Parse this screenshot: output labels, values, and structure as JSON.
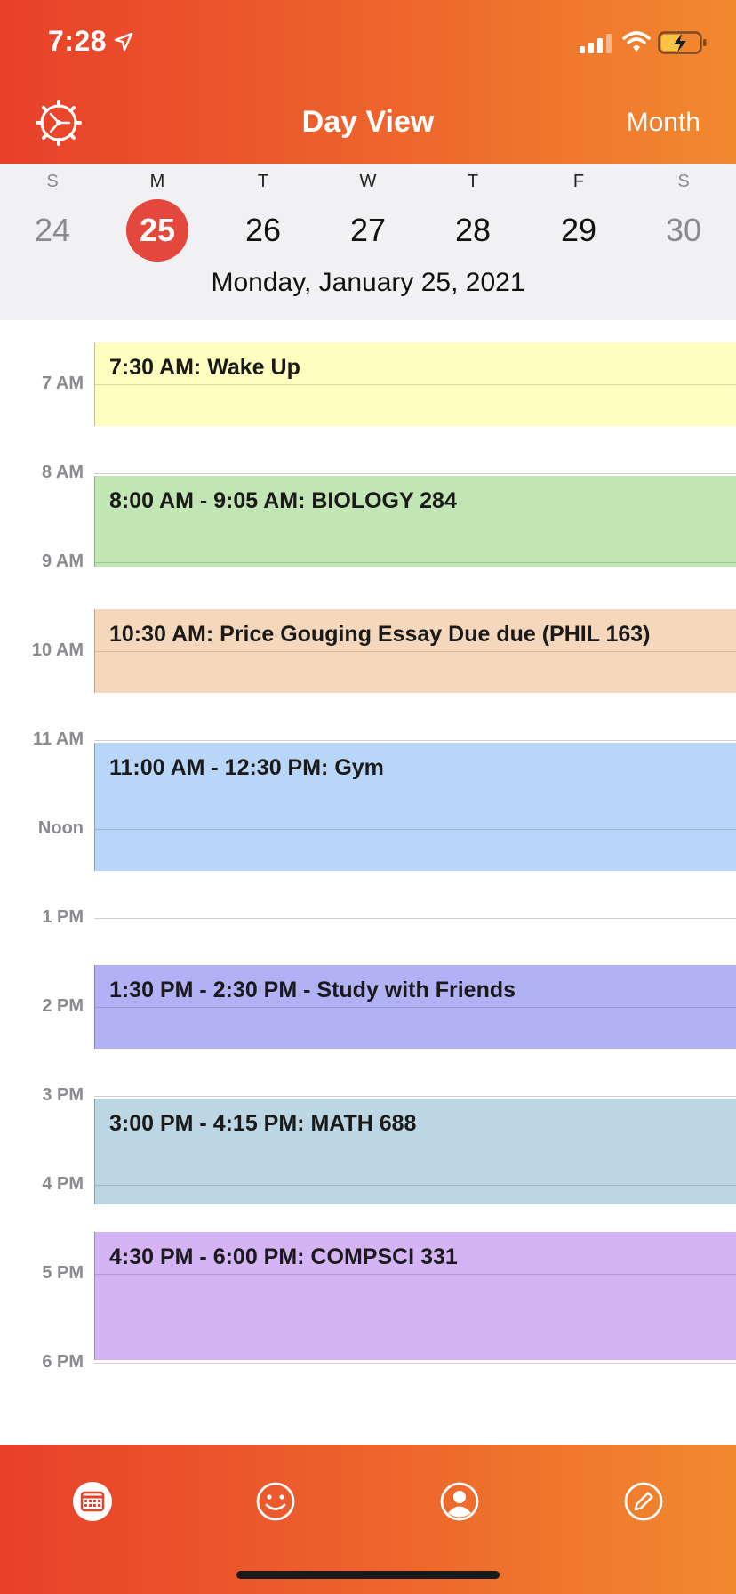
{
  "status_bar": {
    "time": "7:28"
  },
  "header": {
    "title": "Day View",
    "month_button": "Month"
  },
  "week": {
    "days": [
      {
        "dow": "S",
        "num": "24",
        "weekend": true,
        "selected": false
      },
      {
        "dow": "M",
        "num": "25",
        "weekend": false,
        "selected": true
      },
      {
        "dow": "T",
        "num": "26",
        "weekend": false,
        "selected": false
      },
      {
        "dow": "W",
        "num": "27",
        "weekend": false,
        "selected": false
      },
      {
        "dow": "T",
        "num": "28",
        "weekend": false,
        "selected": false
      },
      {
        "dow": "F",
        "num": "29",
        "weekend": false,
        "selected": false
      },
      {
        "dow": "S",
        "num": "30",
        "weekend": true,
        "selected": false
      }
    ],
    "full_date": "Monday, January 25, 2021"
  },
  "timeline": {
    "hours": [
      "7 AM",
      "8 AM",
      "9 AM",
      "10 AM",
      "11 AM",
      "Noon",
      "1 PM",
      "2 PM",
      "3 PM",
      "4 PM",
      "5 PM",
      "6 PM"
    ],
    "events": [
      {
        "title": "7:30 AM: Wake Up",
        "start": 6.5,
        "end": 7.5,
        "color": "#fefebe"
      },
      {
        "title": "8:00 AM - 9:05 AM: BIOLOGY 284",
        "start": 8.0,
        "end": 9.083,
        "color": "#c1e5b3"
      },
      {
        "title": "10:30 AM: Price Gouging Essay Due due (PHIL 163)",
        "start": 9.5,
        "end": 10.5,
        "color": "#f5d7bb"
      },
      {
        "title": "11:00 AM - 12:30 PM: Gym",
        "start": 11.0,
        "end": 12.5,
        "color": "#b8d6f8"
      },
      {
        "title": "1:30 PM - 2:30 PM - Study with Friends",
        "start": 13.5,
        "end": 14.5,
        "color": "#b1b1f6"
      },
      {
        "title": "3:00 PM - 4:15 PM: MATH 688",
        "start": 15.0,
        "end": 16.25,
        "color": "#bdd6e3"
      },
      {
        "title": "4:30 PM - 6:00 PM: COMPSCI 331",
        "start": 16.5,
        "end": 18.0,
        "color": "#d4b4f5"
      }
    ]
  },
  "tabbar": {
    "tabs": [
      {
        "icon": "calendar-icon",
        "active": true
      },
      {
        "icon": "smiley-icon",
        "active": false
      },
      {
        "icon": "profile-icon",
        "active": false
      },
      {
        "icon": "edit-icon",
        "active": false
      }
    ]
  },
  "colors": {
    "accent": "#e4473b",
    "header_start": "#e8402a",
    "header_end": "#f2892f"
  }
}
